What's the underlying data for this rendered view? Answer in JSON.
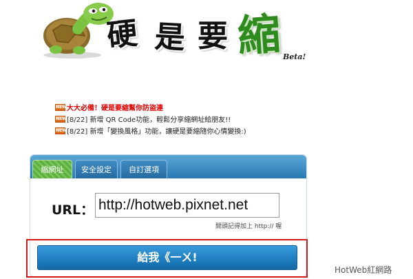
{
  "logo": {
    "chars": [
      "硬",
      "是",
      "要",
      "縮"
    ],
    "beta": "Beta!",
    "turtle_icon": "turtle-icon"
  },
  "news": [
    {
      "badge": "NEW",
      "text": "大大必備！硬是要縮幫你防盜連",
      "style": "red"
    },
    {
      "badge": "NEW",
      "text": "[8/22] 新增 QR Code功能，輕鬆分享縮網址給朋友!!",
      "style": "normal"
    },
    {
      "badge": "NEW",
      "text": "[8/22] 新增「變換風格」功能，讓硬是要縮隨你心情變換:)",
      "style": "normal"
    }
  ],
  "tabs": [
    {
      "label": "縮網址",
      "active": true
    },
    {
      "label": "安全設定",
      "active": false
    },
    {
      "label": "自訂選項",
      "active": false
    }
  ],
  "form": {
    "url_label": "URL：",
    "url_value": "http://hotweb.pixnet.net",
    "hint": "開頭記得加上 http:// 喔",
    "submit_label": "給我《一ㄨ!"
  },
  "watermark": "HotWeb紅網路",
  "colors": {
    "tab_bar": "#2b79b3",
    "active_tab": "#5cae3e",
    "button": "#1f7fc0",
    "highlight_border": "#d01818",
    "news_red": "#e00000"
  }
}
